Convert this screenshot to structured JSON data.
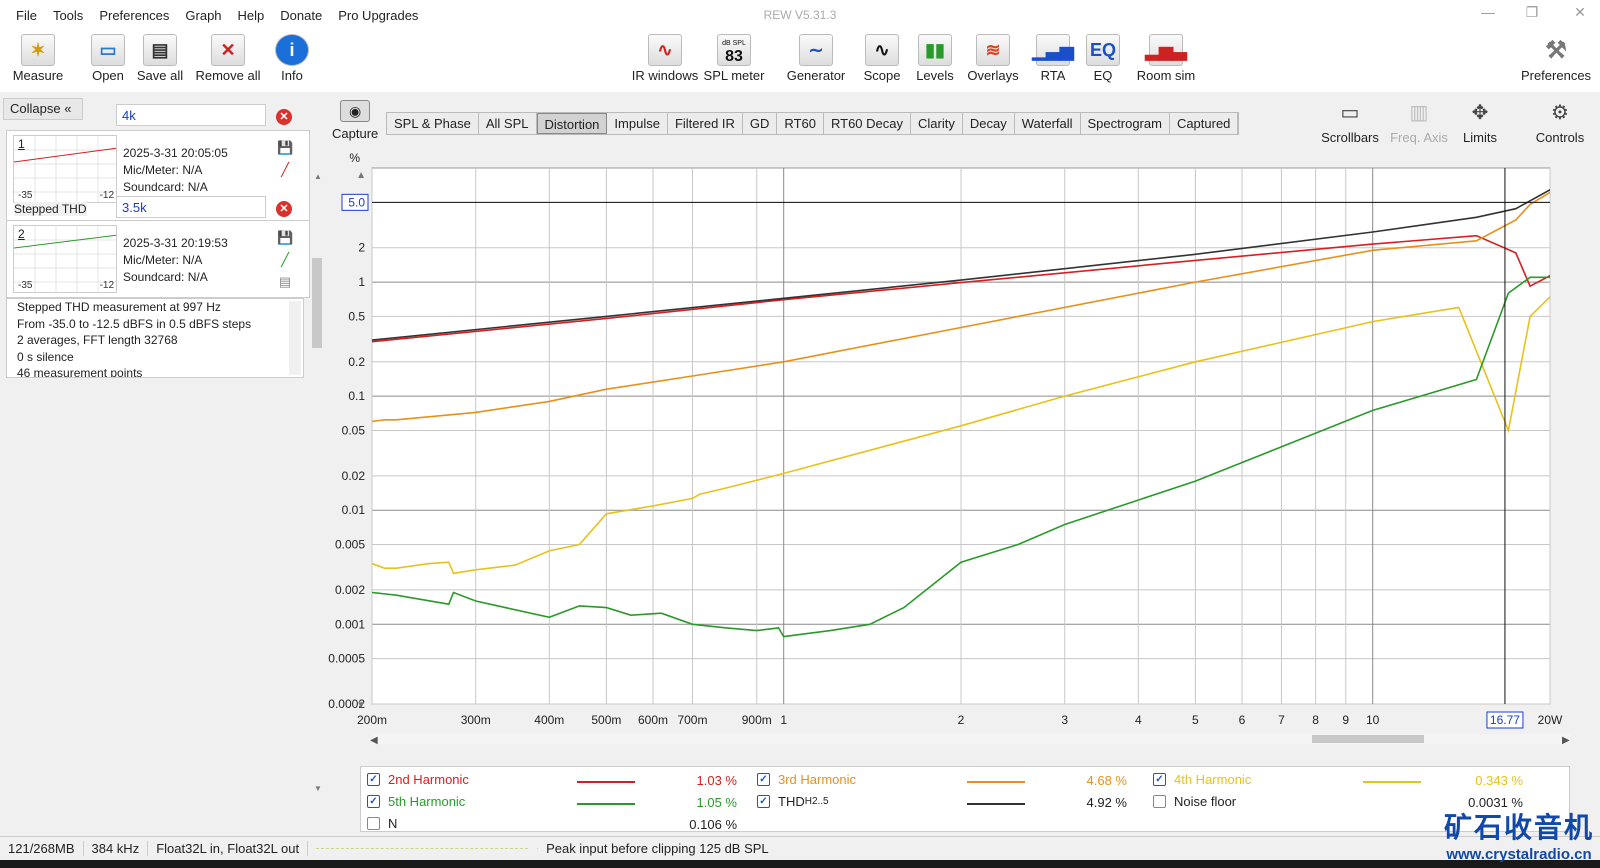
{
  "app": {
    "title": "REW V5.31.3",
    "win_min": "—",
    "win_max": "❐",
    "win_close": "✕"
  },
  "menu": [
    "File",
    "Tools",
    "Preferences",
    "Graph",
    "Help",
    "Donate",
    "Pro Upgrades"
  ],
  "toolbar": {
    "left": [
      {
        "label": "Measure",
        "icon": "microphone-icon"
      },
      {
        "label": "Open",
        "icon": "folder-icon"
      },
      {
        "label": "Save all",
        "icon": "save-all-icon"
      },
      {
        "label": "Remove all",
        "icon": "remove-all-icon"
      },
      {
        "label": "Info",
        "icon": "info-icon"
      }
    ],
    "center": [
      {
        "label": "IR windows",
        "icon": "ir-windows-icon",
        "glyph": "∿"
      },
      {
        "label": "SPL meter",
        "icon": "spl-meter-icon",
        "glyph": "83",
        "caption": "dB SPL"
      },
      {
        "label": "Generator",
        "icon": "generator-icon",
        "glyph": "∼"
      },
      {
        "label": "Scope",
        "icon": "scope-icon",
        "glyph": "∿"
      },
      {
        "label": "Levels",
        "icon": "levels-icon",
        "glyph": "▮▮"
      },
      {
        "label": "Overlays",
        "icon": "overlays-icon",
        "glyph": "≋"
      },
      {
        "label": "RTA",
        "icon": "rta-icon",
        "glyph": "▁▃▅"
      },
      {
        "label": "EQ",
        "icon": "eq-icon",
        "glyph": "EQ"
      },
      {
        "label": "Room sim",
        "icon": "room-sim-icon",
        "glyph": "▂▅▃"
      }
    ],
    "right": {
      "label": "Preferences",
      "icon": "wrench-icon"
    }
  },
  "panel": {
    "collapse_label": "Collapse",
    "measurements": [
      {
        "num": "1",
        "name": "4k",
        "date": "2025-3-31 20:05:05",
        "mic": "Mic/Meter: N/A",
        "soundcard": "Soundcard: N/A",
        "ax_left": "-35",
        "ax_right": "-12",
        "color": "#d42020"
      },
      {
        "num": "2",
        "name": "3.5k",
        "date": "2025-3-31 20:19:53",
        "mic": "Mic/Meter: N/A",
        "soundcard": "Soundcard: N/A",
        "ax_left": "-35",
        "ax_right": "-12",
        "color": "#2a9a2a",
        "type_label": "Stepped THD"
      }
    ],
    "notes": [
      "Stepped THD measurement at 997 Hz",
      "From -35.0 to -12.5 dBFS in 0.5 dBFS steps",
      "2 averages, FFT length 32768",
      "0 s silence",
      "46 measurement points"
    ]
  },
  "graph_tabs": [
    "SPL & Phase",
    "All SPL",
    "Distortion",
    "Impulse",
    "Filtered IR",
    "GD",
    "RT60",
    "RT60 Decay",
    "Clarity",
    "Decay",
    "Waterfall",
    "Spectrogram",
    "Captured"
  ],
  "active_tab": "Distortion",
  "capture_label": "Capture",
  "right_tools": [
    {
      "label": "Scrollbars",
      "icon": "scrollbars-icon",
      "enabled": true
    },
    {
      "label": "Freq. Axis",
      "icon": "freq-axis-icon",
      "enabled": false
    },
    {
      "label": "Limits",
      "icon": "limits-icon",
      "enabled": true
    },
    {
      "label": "Controls",
      "icon": "gear-icon",
      "enabled": true
    }
  ],
  "chart_data": {
    "type": "line",
    "y_unit": "%",
    "y_scale": "log",
    "x_scale": "log",
    "ylim": [
      0.0002,
      10
    ],
    "xlim": [
      0.2,
      20
    ],
    "y_ticks": [
      {
        "v": 5,
        "t": "5.0",
        "boxed": true
      },
      {
        "v": 2,
        "t": "2"
      },
      {
        "v": 1,
        "t": "1"
      },
      {
        "v": 0.5,
        "t": "0.5"
      },
      {
        "v": 0.2,
        "t": "0.2"
      },
      {
        "v": 0.1,
        "t": "0.1"
      },
      {
        "v": 0.05,
        "t": "0.05"
      },
      {
        "v": 0.02,
        "t": "0.02"
      },
      {
        "v": 0.01,
        "t": "0.01"
      },
      {
        "v": 0.005,
        "t": "0.005"
      },
      {
        "v": 0.002,
        "t": "0.002"
      },
      {
        "v": 0.001,
        "t": "0.001"
      },
      {
        "v": 0.0005,
        "t": "0.0005"
      },
      {
        "v": 0.0002,
        "t": "0.0002"
      }
    ],
    "x_ticks": [
      {
        "v": 0.2,
        "t": "200m"
      },
      {
        "v": 0.3,
        "t": "300m"
      },
      {
        "v": 0.4,
        "t": "400m"
      },
      {
        "v": 0.5,
        "t": "500m"
      },
      {
        "v": 0.6,
        "t": "600m"
      },
      {
        "v": 0.7,
        "t": "700m"
      },
      {
        "v": 0.9,
        "t": "900m"
      },
      {
        "v": 1,
        "t": "1"
      },
      {
        "v": 2,
        "t": "2"
      },
      {
        "v": 3,
        "t": "3"
      },
      {
        "v": 4,
        "t": "4"
      },
      {
        "v": 5,
        "t": "5"
      },
      {
        "v": 6,
        "t": "6"
      },
      {
        "v": 7,
        "t": "7"
      },
      {
        "v": 8,
        "t": "8"
      },
      {
        "v": 9,
        "t": "9"
      },
      {
        "v": 10,
        "t": "10"
      },
      {
        "v": 20,
        "t": "20W"
      }
    ],
    "cursor": {
      "x": 16.77,
      "label": "16.77",
      "y": 5.0
    },
    "series": [
      {
        "name": "2nd Harmonic",
        "color": "#d42020",
        "points": [
          [
            0.2,
            0.3
          ],
          [
            0.5,
            0.48
          ],
          [
            1,
            0.7
          ],
          [
            2,
            0.99
          ],
          [
            5,
            1.55
          ],
          [
            10,
            2.15
          ],
          [
            15,
            2.55
          ],
          [
            17.5,
            1.8
          ],
          [
            18.5,
            0.92
          ],
          [
            21,
            1.3
          ]
        ]
      },
      {
        "name": "3rd Harmonic",
        "color": "#e8901a",
        "points": [
          [
            0.2,
            0.06
          ],
          [
            0.21,
            0.062
          ],
          [
            0.22,
            0.062
          ],
          [
            0.3,
            0.072
          ],
          [
            0.4,
            0.09
          ],
          [
            0.5,
            0.115
          ],
          [
            0.7,
            0.15
          ],
          [
            1,
            0.2
          ],
          [
            2,
            0.4
          ],
          [
            5,
            1.0
          ],
          [
            10,
            1.9
          ],
          [
            15,
            2.3
          ],
          [
            17.5,
            3.5
          ],
          [
            18.5,
            4.8
          ],
          [
            21,
            7.1
          ]
        ]
      },
      {
        "name": "4th Harmonic",
        "color": "#e8c21c",
        "points": [
          [
            0.2,
            0.0034
          ],
          [
            0.21,
            0.0031
          ],
          [
            0.22,
            0.0031
          ],
          [
            0.25,
            0.0034
          ],
          [
            0.27,
            0.0035
          ],
          [
            0.275,
            0.0028
          ],
          [
            0.3,
            0.003
          ],
          [
            0.35,
            0.0033
          ],
          [
            0.4,
            0.0044
          ],
          [
            0.45,
            0.005
          ],
          [
            0.5,
            0.0093
          ],
          [
            0.6,
            0.0109
          ],
          [
            0.7,
            0.0127
          ],
          [
            0.72,
            0.0138
          ],
          [
            0.8,
            0.0157
          ],
          [
            1,
            0.021
          ],
          [
            2,
            0.055
          ],
          [
            3,
            0.1
          ],
          [
            5,
            0.2
          ],
          [
            10,
            0.45
          ],
          [
            14,
            0.6
          ],
          [
            17,
            0.05
          ],
          [
            18.5,
            0.5
          ],
          [
            21,
            0.95
          ]
        ]
      },
      {
        "name": "5th Harmonic",
        "color": "#2a9a2a",
        "points": [
          [
            0.2,
            0.0019
          ],
          [
            0.22,
            0.0018
          ],
          [
            0.27,
            0.0015
          ],
          [
            0.275,
            0.0019
          ],
          [
            0.3,
            0.0016
          ],
          [
            0.4,
            0.00115
          ],
          [
            0.45,
            0.00145
          ],
          [
            0.5,
            0.0014
          ],
          [
            0.55,
            0.0012
          ],
          [
            0.62,
            0.00125
          ],
          [
            0.7,
            0.001
          ],
          [
            0.8,
            0.00093
          ],
          [
            0.9,
            0.00088
          ],
          [
            0.98,
            0.00093
          ],
          [
            1,
            0.00078
          ],
          [
            1.2,
            0.00088
          ],
          [
            1.4,
            0.001
          ],
          [
            1.6,
            0.0014
          ],
          [
            2,
            0.0035
          ],
          [
            2.5,
            0.005
          ],
          [
            3,
            0.0075
          ],
          [
            5,
            0.018
          ],
          [
            10,
            0.075
          ],
          [
            15,
            0.14
          ],
          [
            17,
            0.8
          ],
          [
            18.5,
            1.1
          ],
          [
            21,
            1.1
          ]
        ]
      },
      {
        "name": "THD2..5",
        "color": "#333333",
        "points": [
          [
            0.2,
            0.31
          ],
          [
            0.5,
            0.5
          ],
          [
            1,
            0.72
          ],
          [
            2,
            1.04
          ],
          [
            5,
            1.75
          ],
          [
            10,
            2.75
          ],
          [
            15,
            3.7
          ],
          [
            17.5,
            4.4
          ],
          [
            21,
            7.4
          ]
        ]
      }
    ]
  },
  "legend": [
    {
      "name": "2nd Harmonic",
      "value": "1.03 %",
      "color": "#d42020",
      "checked": true,
      "col": 0,
      "row": 0
    },
    {
      "name": "3rd Harmonic",
      "value": "4.68 %",
      "color": "#e8901a",
      "checked": true,
      "col": 1,
      "row": 0
    },
    {
      "name": "4th Harmonic",
      "value": "0.343 %",
      "color": "#e8c21c",
      "checked": true,
      "col": 2,
      "row": 0
    },
    {
      "name": "5th Harmonic",
      "value": "1.05 %",
      "color": "#2a9a2a",
      "checked": true,
      "col": 0,
      "row": 1
    },
    {
      "name": "THD",
      "sub": "H2..5",
      "value": "4.92 %",
      "color": "#333333",
      "checked": true,
      "col": 1,
      "row": 1
    },
    {
      "name": "Noise floor",
      "value": "0.0031 %",
      "color": "",
      "checked": false,
      "col": 2,
      "row": 1
    },
    {
      "name": "N",
      "value": "0.106 %",
      "color": "",
      "checked": false,
      "col": 0,
      "row": 2
    }
  ],
  "status": {
    "memory": "121/268MB",
    "rate": "384 kHz",
    "format": "Float32L in, Float32L out",
    "peak": "Peak input before clipping 125 dB SPL"
  },
  "watermark": {
    "cn": "矿石收音机",
    "url": "www.crystalradio.cn"
  }
}
